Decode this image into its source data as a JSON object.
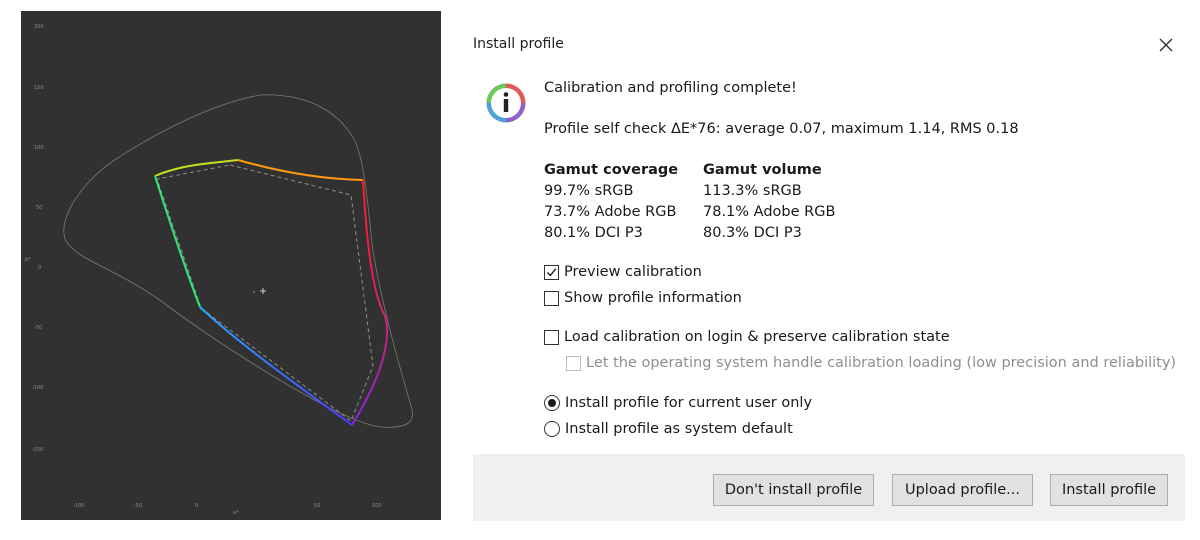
{
  "plot": {
    "y_ticks": [
      "200",
      "150",
      "100",
      "50",
      "0",
      "-50",
      "-100",
      "-150"
    ],
    "x_ticks": [
      "-100",
      "-50",
      "0",
      "50",
      "100"
    ],
    "x_axis_label": "a*",
    "y_axis_label": "b*"
  },
  "dialog": {
    "title": "Install profile",
    "heading": "Calibration and profiling complete!",
    "self_check": "Profile self check ΔE*76: average 0.07, maximum 1.14, RMS 0.18",
    "gamut_coverage": {
      "header": "Gamut coverage",
      "rows": [
        "99.7% sRGB",
        "73.7% Adobe RGB",
        "80.1% DCI P3"
      ]
    },
    "gamut_volume": {
      "header": "Gamut volume",
      "rows": [
        "113.3% sRGB",
        "78.1% Adobe RGB",
        "80.3% DCI P3"
      ]
    },
    "options": {
      "preview_calibration": {
        "label": "Preview calibration",
        "checked": true
      },
      "show_profile_info": {
        "label": "Show profile information",
        "checked": false
      },
      "load_calibration": {
        "label": "Load calibration on login & preserve calibration state",
        "checked": false
      },
      "os_handle_calibration": {
        "label": "Let the operating system handle calibration loading (low precision and reliability)",
        "checked": false,
        "disabled": true
      },
      "install_current_user": {
        "label": "Install profile for current user only",
        "selected": true
      },
      "install_system_default": {
        "label": "Install profile as system default",
        "selected": false
      }
    },
    "buttons": {
      "dont_install": "Don't install profile",
      "upload": "Upload profile...",
      "install": "Install profile"
    }
  },
  "colors": {
    "plot_background": "#313131",
    "footer_background": "#f0f0f0",
    "button_face": "#e1e1e1"
  }
}
